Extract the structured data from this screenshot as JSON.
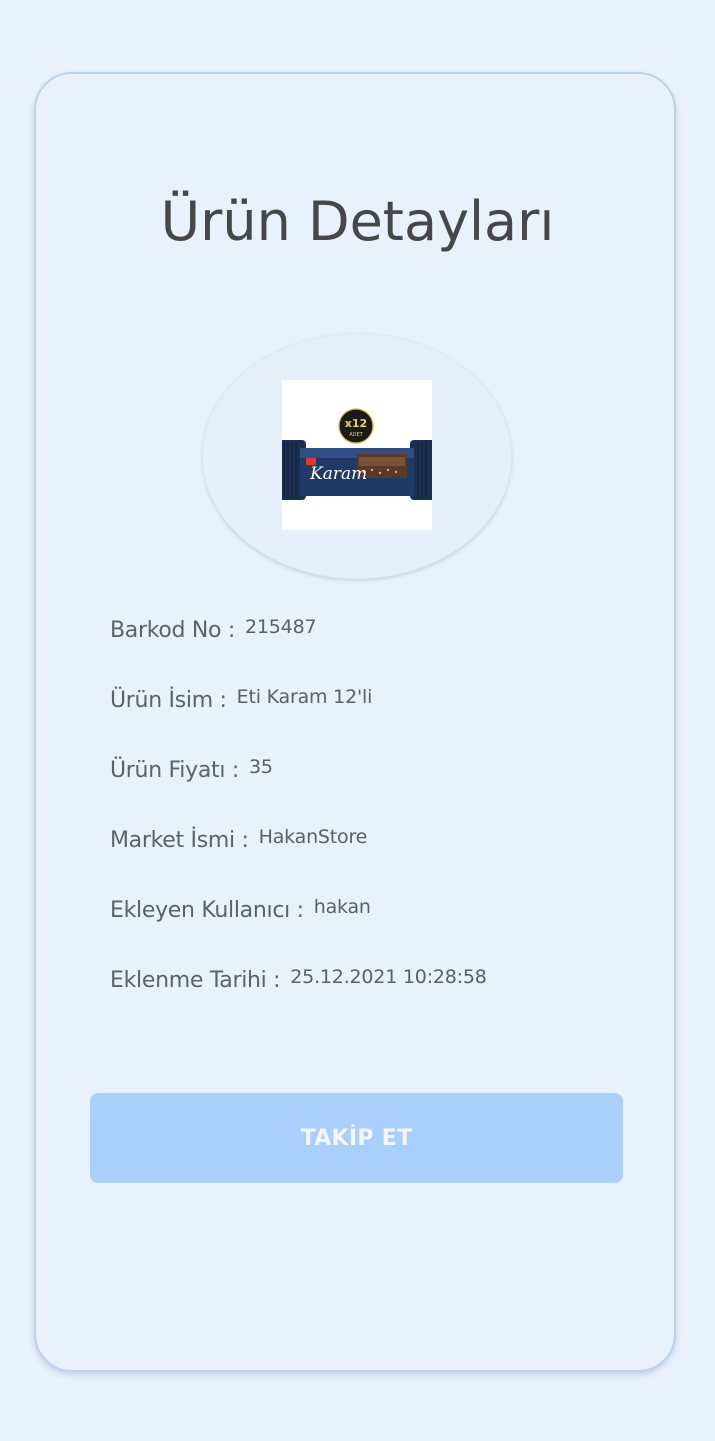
{
  "page": {
    "title": "Ürün Detayları"
  },
  "product_image": {
    "alt_icon": "product-image",
    "badge_count": "x12",
    "badge_sub": "ADET",
    "brand": "Karam"
  },
  "details": [
    {
      "label": "Barkod No :",
      "value": "215487"
    },
    {
      "label": "Ürün İsim :",
      "value": "Eti Karam 12'li"
    },
    {
      "label": "Ürün Fiyatı :",
      "value": "35"
    },
    {
      "label": "Market İsmi :",
      "value": "HakanStore"
    },
    {
      "label": "Ekleyen Kullanıcı :",
      "value": "hakan"
    },
    {
      "label": "Eklenme Tarihi :",
      "value": "25.12.2021 10:28:58"
    }
  ],
  "actions": {
    "follow_label": "TAKİP ET"
  },
  "colors": {
    "background": "#e9f2fd",
    "button": "#a9d0fb",
    "text": "#474747"
  }
}
